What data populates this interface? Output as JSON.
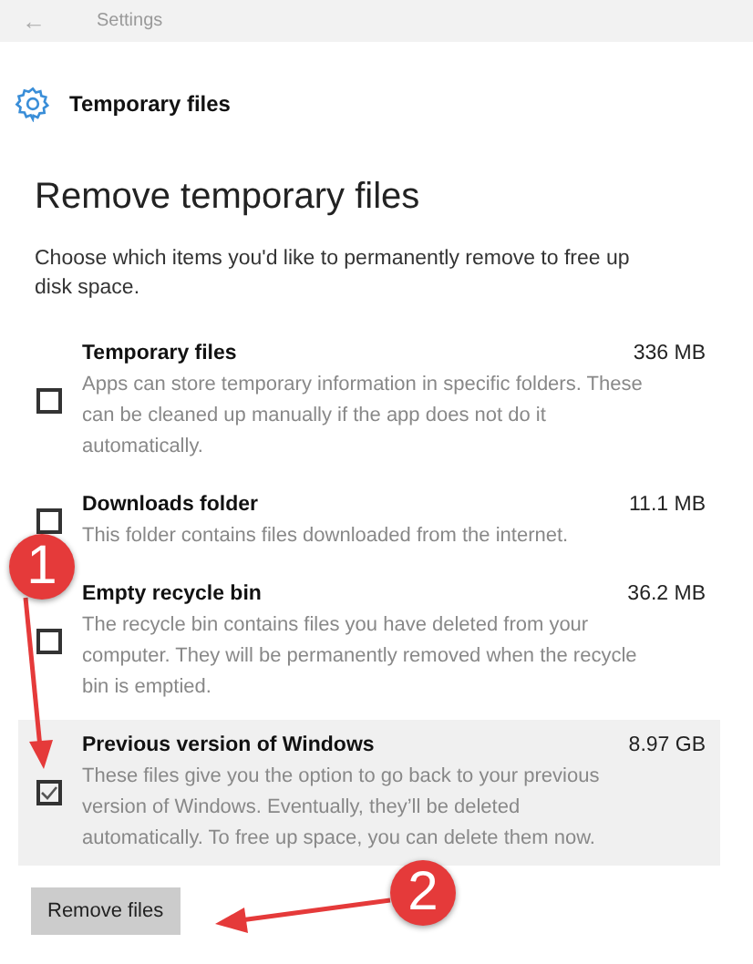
{
  "window": {
    "back": "←",
    "title": "Settings"
  },
  "page_title": "Temporary files",
  "heading": "Remove temporary files",
  "intro": "Choose which items you'd like to permanently remove to free up disk space.",
  "items": [
    {
      "name": "Temporary files",
      "size": "336 MB",
      "description": "Apps can store temporary information in specific folders. These can be cleaned up manually if the app does not do it automatically.",
      "checked": false,
      "selected": false
    },
    {
      "name": "Downloads folder",
      "size": "11.1 MB",
      "description": "This folder contains files downloaded from the internet.",
      "checked": false,
      "selected": false
    },
    {
      "name": "Empty recycle bin",
      "size": "36.2 MB",
      "description": "The recycle bin contains files you have deleted from your computer. They will be permanently removed when the recycle bin is emptied.",
      "checked": false,
      "selected": false
    },
    {
      "name": "Previous version of Windows",
      "size": "8.97 GB",
      "description": "These files give you the option to go back to your previous version of Windows. Eventually, they’ll be deleted automatically. To free up space, you can delete them now.",
      "checked": true,
      "selected": true
    }
  ],
  "button": "Remove files",
  "annotations": [
    {
      "label": "1"
    },
    {
      "label": "2"
    }
  ]
}
